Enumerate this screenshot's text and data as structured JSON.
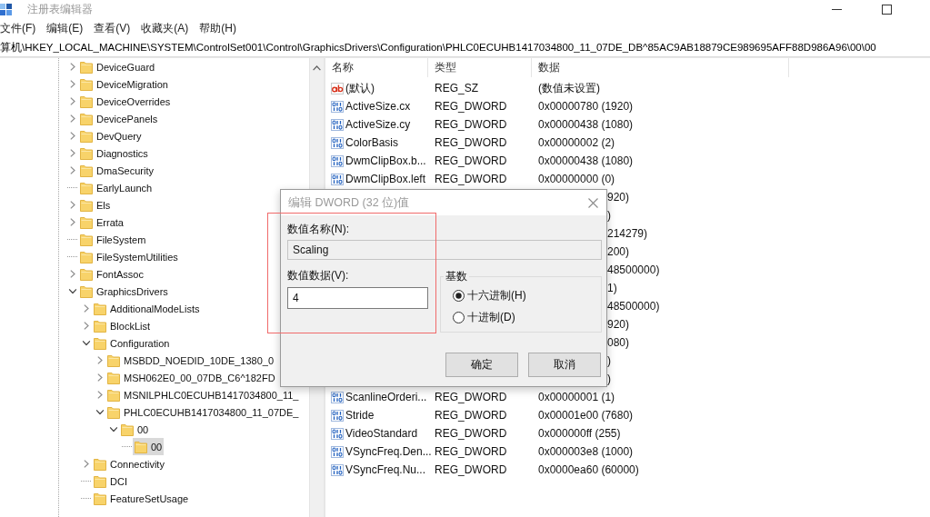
{
  "window": {
    "title": "注册表编辑器",
    "active": false
  },
  "menu": [
    "文件(F)",
    "编辑(E)",
    "查看(V)",
    "收藏夹(A)",
    "帮助(H)"
  ],
  "address_bar": {
    "value": "算机\\HKEY_LOCAL_MACHINE\\SYSTEM\\ControlSet001\\Control\\GraphicsDrivers\\Configuration\\PHLC0ECUHB1417034800_11_07DE_DB^85AC9AB18879CE989695AFF88D986A96\\00\\00"
  },
  "tree": {
    "items": [
      {
        "label": "DeviceGuard",
        "expandable": true,
        "expanded": false,
        "selected": false
      },
      {
        "label": "DeviceMigration",
        "expandable": true,
        "expanded": false,
        "selected": false
      },
      {
        "label": "DeviceOverrides",
        "expandable": true,
        "expanded": false,
        "selected": false
      },
      {
        "label": "DevicePanels",
        "expandable": true,
        "expanded": false,
        "selected": false
      },
      {
        "label": "DevQuery",
        "expandable": true,
        "expanded": false,
        "selected": false
      },
      {
        "label": "Diagnostics",
        "expandable": true,
        "expanded": false,
        "selected": false
      },
      {
        "label": "DmaSecurity",
        "expandable": true,
        "expanded": false,
        "selected": false
      },
      {
        "label": "EarlyLaunch",
        "expandable": false,
        "selected": false
      },
      {
        "label": "Els",
        "expandable": true,
        "expanded": false,
        "selected": false
      },
      {
        "label": "Errata",
        "expandable": true,
        "expanded": false,
        "selected": false
      },
      {
        "label": "FileSystem",
        "expandable": false,
        "selected": false
      },
      {
        "label": "FileSystemUtilities",
        "expandable": false,
        "selected": false
      },
      {
        "label": "FontAssoc",
        "expandable": true,
        "expanded": false,
        "selected": false
      },
      {
        "label": "GraphicsDrivers",
        "expandable": true,
        "expanded": true,
        "selected": false,
        "children": [
          {
            "label": "AdditionalModeLists",
            "expandable": true,
            "expanded": false,
            "selected": false
          },
          {
            "label": "BlockList",
            "expandable": true,
            "expanded": false,
            "selected": false
          },
          {
            "label": "Configuration",
            "expandable": true,
            "expanded": true,
            "selected": false,
            "children": [
              {
                "label": "MSBDD_NOEDID_10DE_1380_0",
                "expandable": true,
                "expanded": false,
                "selected": false
              },
              {
                "label": "MSH062E0_00_07DB_C6^182FD",
                "expandable": true,
                "expanded": false,
                "selected": false
              },
              {
                "label": "MSNILPHLC0ECUHB1417034800_11_",
                "expandable": true,
                "expanded": false,
                "selected": false
              },
              {
                "label": "PHLC0ECUHB1417034800_11_07DE_",
                "expandable": true,
                "expanded": true,
                "selected": false,
                "children": [
                  {
                    "label": "00",
                    "expandable": true,
                    "expanded": true,
                    "selected": false,
                    "children": [
                      {
                        "label": "00",
                        "expandable": false,
                        "selected": true
                      }
                    ]
                  }
                ]
              }
            ]
          },
          {
            "label": "Connectivity",
            "expandable": true,
            "expanded": false,
            "selected": false
          },
          {
            "label": "DCI",
            "expandable": false,
            "selected": false
          },
          {
            "label": "FeatureSetUsage",
            "expandable": false,
            "selected": false
          }
        ]
      }
    ]
  },
  "list": {
    "columns": [
      "名称",
      "类型",
      "数据"
    ],
    "rows": [
      {
        "kind": "string",
        "name": "(默认)",
        "type": "REG_SZ",
        "data": "(数值未设置)"
      },
      {
        "kind": "dword",
        "name": "ActiveSize.cx",
        "type": "REG_DWORD",
        "data": "0x00000780 (1920)"
      },
      {
        "kind": "dword",
        "name": "ActiveSize.cy",
        "type": "REG_DWORD",
        "data": "0x00000438 (1080)"
      },
      {
        "kind": "dword",
        "name": "ColorBasis",
        "type": "REG_DWORD",
        "data": "0x00000002 (2)"
      },
      {
        "kind": "dword",
        "name": "DwmClipBox.b...",
        "type": "REG_DWORD",
        "data": "0x00000438 (1080)"
      },
      {
        "kind": "dword",
        "name": "DwmClipBox.left",
        "type": "REG_DWORD",
        "data": "0x00000000 (0)"
      },
      {
        "kind": "covered",
        "data": "920)"
      },
      {
        "kind": "covered",
        "data": ")"
      },
      {
        "kind": "covered",
        "data": "214279)"
      },
      {
        "kind": "covered",
        "data": "200)"
      },
      {
        "kind": "covered",
        "data": "48500000)"
      },
      {
        "kind": "covered",
        "data": "1)"
      },
      {
        "kind": "covered",
        "data": "48500000)"
      },
      {
        "kind": "covered",
        "data": "920)"
      },
      {
        "kind": "covered",
        "data": "080)"
      },
      {
        "kind": "covered",
        "data": ")"
      },
      {
        "kind": "covered",
        "data": ")"
      },
      {
        "kind": "dword",
        "name": "ScanlineOrderi...",
        "type": "REG_DWORD",
        "data": "0x00000001 (1)"
      },
      {
        "kind": "dword",
        "name": "Stride",
        "type": "REG_DWORD",
        "data": "0x00001e00 (7680)"
      },
      {
        "kind": "dword",
        "name": "VideoStandard",
        "type": "REG_DWORD",
        "data": "0x000000ff (255)"
      },
      {
        "kind": "dword",
        "name": "VSyncFreq.Den...",
        "type": "REG_DWORD",
        "data": "0x000003e8 (1000)"
      },
      {
        "kind": "dword",
        "name": "VSyncFreq.Nu...",
        "type": "REG_DWORD",
        "data": "0x0000ea60 (60000)"
      }
    ]
  },
  "dialog": {
    "title": "编辑 DWORD (32 位)值",
    "active": false,
    "fields": [
      {
        "label": "数值名称(N):",
        "value": "Scaling",
        "disabled": true
      },
      {
        "label": "数值数据(V):",
        "value": "4",
        "disabled": false
      }
    ],
    "base_group": {
      "title": "基数",
      "options": [
        {
          "label": "十六进制(H)",
          "selected": true
        },
        {
          "label": "十进制(D)",
          "selected": false
        }
      ]
    },
    "buttons": [
      "确定",
      "取消"
    ]
  }
}
